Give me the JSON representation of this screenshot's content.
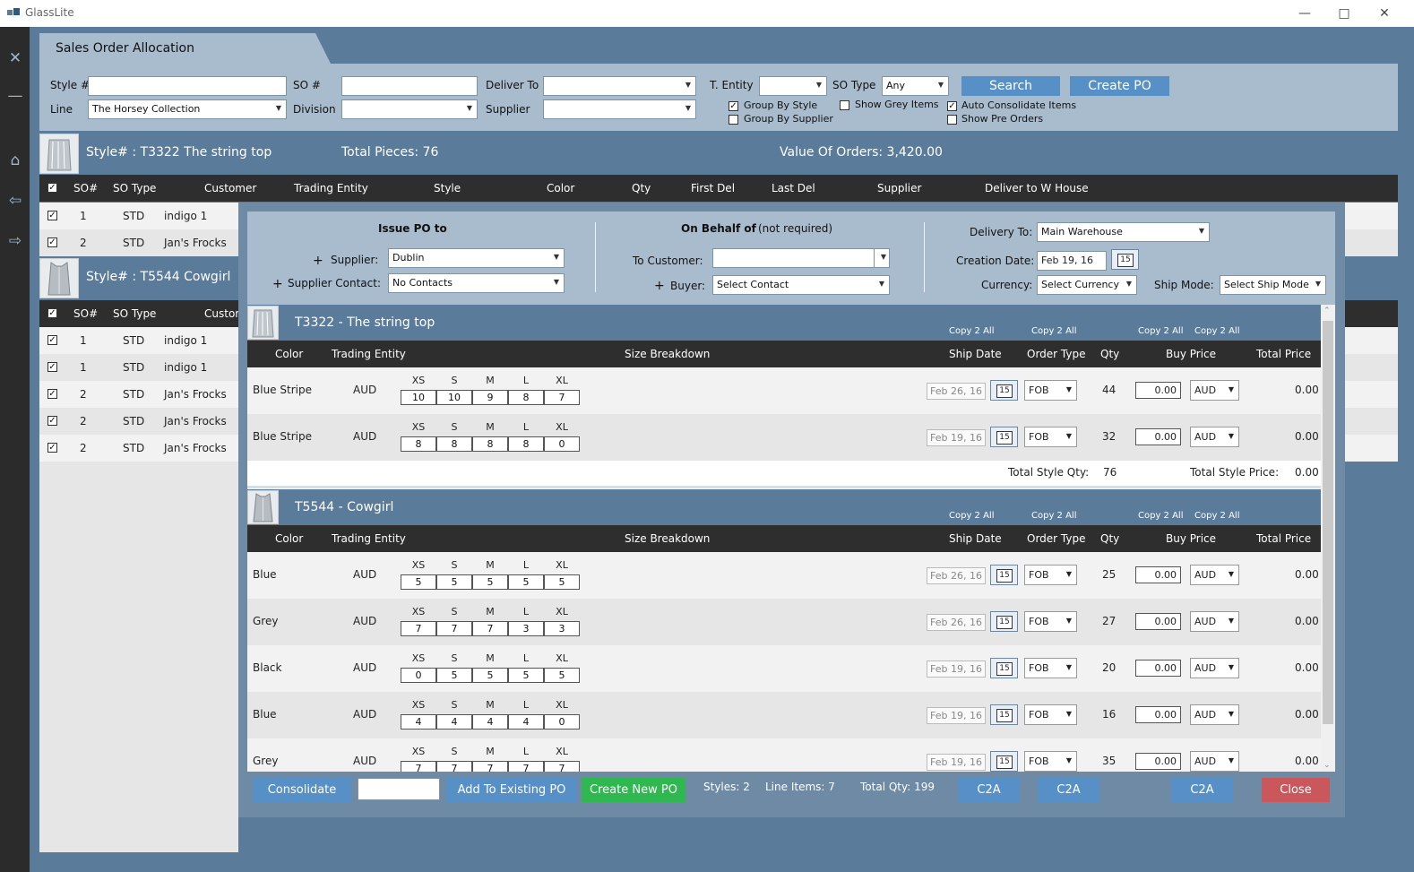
{
  "app": {
    "title": "GlassLite"
  },
  "tab": {
    "label": "Sales Order Allocation"
  },
  "filters": {
    "style_label": "Style #",
    "so_label": "SO #",
    "deliver_to_label": "Deliver To",
    "t_entity_label": "T. Entity",
    "so_type_label": "SO Type",
    "so_type_value": "Any",
    "line_label": "Line",
    "line_value": "The Horsey Collection",
    "division_label": "Division",
    "supplier_label": "Supplier",
    "search_label": "Search",
    "create_po_label": "Create PO",
    "group_by_style": "Group By Style",
    "group_by_supplier": "Group By Supplier",
    "show_grey": "Show Grey Items",
    "auto_consolidate": "Auto Consolidate Items",
    "show_pre_orders": "Show Pre Orders"
  },
  "background": {
    "group1": {
      "style": "Style# : T3322 The string top",
      "total_pieces": "Total Pieces: 76",
      "value": "Value Of Orders: 3,420.00"
    },
    "group2": {
      "style": "Style# : T5544 Cowgirl"
    },
    "columns": [
      "SO#",
      "SO Type",
      "Customer",
      "Trading Entity",
      "Style",
      "Color",
      "Qty",
      "First Del",
      "Last Del",
      "Supplier",
      "Deliver to W House"
    ],
    "columns2": [
      "SO#",
      "SO Type",
      "Custom"
    ],
    "rows1": [
      {
        "so": "1",
        "type": "STD",
        "customer": "indigo 1"
      },
      {
        "so": "2",
        "type": "STD",
        "customer": "Jan's Frocks"
      }
    ],
    "rows2": [
      {
        "so": "1",
        "type": "STD",
        "customer": "indigo 1"
      },
      {
        "so": "1",
        "type": "STD",
        "customer": "indigo 1"
      },
      {
        "so": "2",
        "type": "STD",
        "customer": "Jan's Frocks"
      },
      {
        "so": "2",
        "type": "STD",
        "customer": "Jan's Frocks"
      },
      {
        "so": "2",
        "type": "STD",
        "customer": "Jan's Frocks"
      }
    ]
  },
  "modal": {
    "issue_po_to": "Issue PO to",
    "supplier_label": "Supplier:",
    "supplier_value": "Dublin",
    "supplier_contact_label": "Supplier Contact:",
    "supplier_contact_value": "No Contacts",
    "on_behalf_of": "On Behalf of",
    "not_required": "(not required)",
    "to_customer_label": "To Customer:",
    "buyer_label": "Buyer:",
    "buyer_value": "Select Contact",
    "delivery_to_label": "Delivery To:",
    "delivery_to_value": "Main Warehouse",
    "creation_date_label": "Creation Date:",
    "creation_date_value": "Feb 19, 16",
    "currency_label": "Currency:",
    "currency_value": "Select Currency",
    "ship_mode_label": "Ship Mode:",
    "ship_mode_value": "Select Ship Mode",
    "plus": "+",
    "calendar_day": "15",
    "copy2all": "Copy 2 All",
    "columns": {
      "color": "Color",
      "trading_entity": "Trading Entity",
      "size_breakdown": "Size Breakdown",
      "ship_date": "Ship Date",
      "order_type": "Order Type",
      "qty": "Qty",
      "buy_price": "Buy Price",
      "total_price": "Total Price"
    },
    "sizes": [
      "XS",
      "S",
      "M",
      "L",
      "XL"
    ],
    "sections": [
      {
        "name": "T3322 - The string top",
        "rows": [
          {
            "color": "Blue Stripe",
            "entity": "AUD",
            "sizes": [
              "10",
              "10",
              "9",
              "8",
              "7"
            ],
            "ship": "Feb 26, 16",
            "order_type": "FOB",
            "qty": "44",
            "price": "0.00",
            "currency": "AUD",
            "total": "0.00"
          },
          {
            "color": "Blue Stripe",
            "entity": "AUD",
            "sizes": [
              "8",
              "8",
              "8",
              "8",
              "0"
            ],
            "ship": "Feb 19, 16",
            "order_type": "FOB",
            "qty": "32",
            "price": "0.00",
            "currency": "AUD",
            "total": "0.00"
          }
        ],
        "total_qty_label": "Total Style Qty:",
        "total_qty": "76",
        "total_price_label": "Total Style Price:",
        "total_price": "0.00"
      },
      {
        "name": "T5544 - Cowgirl",
        "rows": [
          {
            "color": "Blue",
            "entity": "AUD",
            "sizes": [
              "5",
              "5",
              "5",
              "5",
              "5"
            ],
            "ship": "Feb 26, 16",
            "order_type": "FOB",
            "qty": "25",
            "price": "0.00",
            "currency": "AUD",
            "total": "0.00"
          },
          {
            "color": "Grey",
            "entity": "AUD",
            "sizes": [
              "7",
              "7",
              "7",
              "3",
              "3"
            ],
            "ship": "Feb 26, 16",
            "order_type": "FOB",
            "qty": "27",
            "price": "0.00",
            "currency": "AUD",
            "total": "0.00"
          },
          {
            "color": "Black",
            "entity": "AUD",
            "sizes": [
              "0",
              "5",
              "5",
              "5",
              "5"
            ],
            "ship": "Feb 19, 16",
            "order_type": "FOB",
            "qty": "20",
            "price": "0.00",
            "currency": "AUD",
            "total": "0.00"
          },
          {
            "color": "Blue",
            "entity": "AUD",
            "sizes": [
              "4",
              "4",
              "4",
              "4",
              "0"
            ],
            "ship": "Feb 19, 16",
            "order_type": "FOB",
            "qty": "16",
            "price": "0.00",
            "currency": "AUD",
            "total": "0.00"
          },
          {
            "color": "Grey",
            "entity": "AUD",
            "sizes": [
              "7",
              "7",
              "7",
              "7",
              "7"
            ],
            "ship": "Feb 19, 16",
            "order_type": "FOB",
            "qty": "35",
            "price": "0.00",
            "currency": "AUD",
            "total": "0.00"
          }
        ]
      }
    ],
    "footer": {
      "consolidate": "Consolidate",
      "add_existing": "Add To Existing PO",
      "create_new": "Create New PO",
      "styles": "Styles: 2",
      "line_items": "Line Items: 7",
      "total_qty": "Total Qty: 199",
      "c2a": "C2A",
      "close": "Close"
    }
  },
  "colors": {
    "header": "#5b7b9a",
    "panel": "#a9bccd",
    "button": "#5790c6",
    "create_new": "#2fb84f",
    "close": "#c9575c"
  }
}
